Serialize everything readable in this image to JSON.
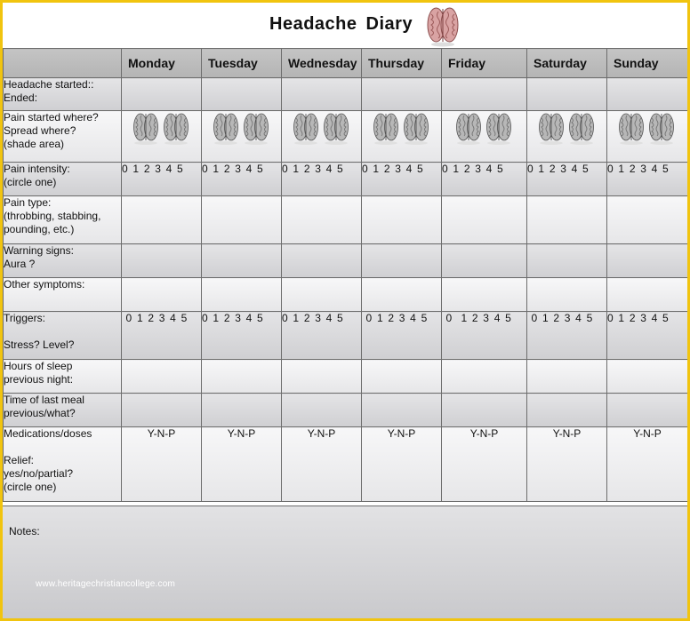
{
  "title": "Headache  Diary",
  "days": [
    "Monday",
    "Tuesday",
    "Wednesday",
    "Thursday",
    "Friday",
    "Saturday",
    "Sunday"
  ],
  "rows": [
    {
      "label": "Headache started::\nEnded:",
      "type": "blank",
      "shade": "g"
    },
    {
      "label": "Pain started where?\nSpread where?\n(shade area)",
      "type": "brains",
      "shade": "w"
    },
    {
      "label": "Pain intensity:\n(circle one)",
      "type": "scale",
      "shade": "g",
      "values": [
        "0 1 2 3 4 5",
        "0 1 2 3 4 5",
        "0 1 2 3 4 5",
        "0 1 2 3 4 5",
        "0 1 2 3 4 5",
        "0 1 2 3 4 5",
        "0 1 2 3 4 5"
      ]
    },
    {
      "label": "Pain type:\n(throbbing,  stabbing,\npounding,  etc.)",
      "type": "blank",
      "shade": "w"
    },
    {
      "label": "Warning signs:\nAura ?",
      "type": "blank",
      "shade": "g"
    },
    {
      "label": "Other symptoms:",
      "type": "blank",
      "shade": "w"
    },
    {
      "label": "Triggers:\n\nStress? Level?",
      "type": "scale",
      "shade": "g",
      "values": [
        " 0 1 2 3 4 5",
        "0 1 2 3 4 5",
        "0 1 2 3 4 5",
        " 0 1 2 3 4 5",
        " 0  1 2 3 4 5",
        " 0 1 2 3 4 5",
        "0 1 2 3 4 5"
      ]
    },
    {
      "label": "Hours of sleep\nprevious night:",
      "type": "blank",
      "shade": "w"
    },
    {
      "label": "Time of last meal\nprevious/what?",
      "type": "blank",
      "shade": "g"
    },
    {
      "label": "Medications/doses\n\nRelief:\nyes/no/partial?\n(circle one)",
      "type": "yn",
      "shade": "w",
      "values": [
        "Y-N-P",
        "Y-N-P",
        "Y-N-P",
        "Y-N-P",
        "Y-N-P",
        "Y-N-P",
        "Y-N-P"
      ]
    }
  ],
  "notes_label": "Notes:",
  "watermark": "www.heritagechristiancollege.com",
  "icons": {
    "title": "brain-color-icon",
    "cell": "brain-gray-icon"
  },
  "colors": {
    "frame": "#f1c40f",
    "header": "#bdbdbd",
    "grid": "#6d6d6d"
  }
}
